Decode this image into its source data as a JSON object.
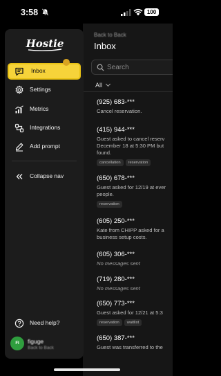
{
  "status_bar": {
    "time": "3:58",
    "battery": "100",
    "icons": [
      "bell-muted-icon",
      "cell-signal-icon",
      "wifi-icon",
      "battery-icon"
    ]
  },
  "brand": {
    "logo_text": "Hostie",
    "colors": {
      "accent": "#f6d33a",
      "accent_border": "#e9c215",
      "badge": "#d8a322",
      "avatar": "#2f9e3e"
    }
  },
  "nav": {
    "items": [
      {
        "label": "Inbox",
        "icon": "inbox-icon",
        "active": true
      },
      {
        "label": "Settings",
        "icon": "gear-icon"
      },
      {
        "label": "Metrics",
        "icon": "chart-icon"
      },
      {
        "label": "Integrations",
        "icon": "integrations-icon"
      },
      {
        "label": "Add prompt",
        "icon": "pencil-icon"
      }
    ],
    "collapse_label": "Collapse nav",
    "help_label": "Need help?"
  },
  "user": {
    "initials": "FI",
    "name": "figuge",
    "location": "Back to Back"
  },
  "main": {
    "back_label": "Back to Back",
    "title": "Inbox",
    "search_placeholder": "Search",
    "filter_label": "All",
    "conversations": [
      {
        "phone": "(925) 683-***",
        "message": "Cancel reservation.",
        "italic": false,
        "tags": []
      },
      {
        "phone": "(415) 944-***",
        "message": "Guest asked to cancel reservation for December 18 at 5:30 PM but it was not found.",
        "message_lines": [
          "Guest asked to cancel reserv",
          "December 18 at 5:30 PM but",
          "found."
        ],
        "italic": false,
        "tags": [
          "cancellation",
          "reservation"
        ]
      },
      {
        "phone": "(650) 678-***",
        "message_lines": [
          "Guest asked for 12/19 at ever",
          "people."
        ],
        "italic": false,
        "tags": [
          "reservation"
        ]
      },
      {
        "phone": "(605) 250-***",
        "message_lines": [
          "Kate from CHIPP asked for a",
          "business setup costs."
        ],
        "italic": false,
        "tags": []
      },
      {
        "phone": "(605) 306-***",
        "message_lines": [
          "No messages sent"
        ],
        "italic": true,
        "tags": []
      },
      {
        "phone": "(719) 280-***",
        "message_lines": [
          "No messages sent"
        ],
        "italic": true,
        "tags": []
      },
      {
        "phone": "(650) 773-***",
        "message_lines": [
          "Guest asked for 12/21 at 5:3"
        ],
        "italic": false,
        "tags": [
          "reservation",
          "waitlist"
        ]
      },
      {
        "phone": "(650) 387-***",
        "message_lines": [
          "Guest was transferred to the"
        ],
        "italic": false,
        "tags": []
      }
    ]
  }
}
